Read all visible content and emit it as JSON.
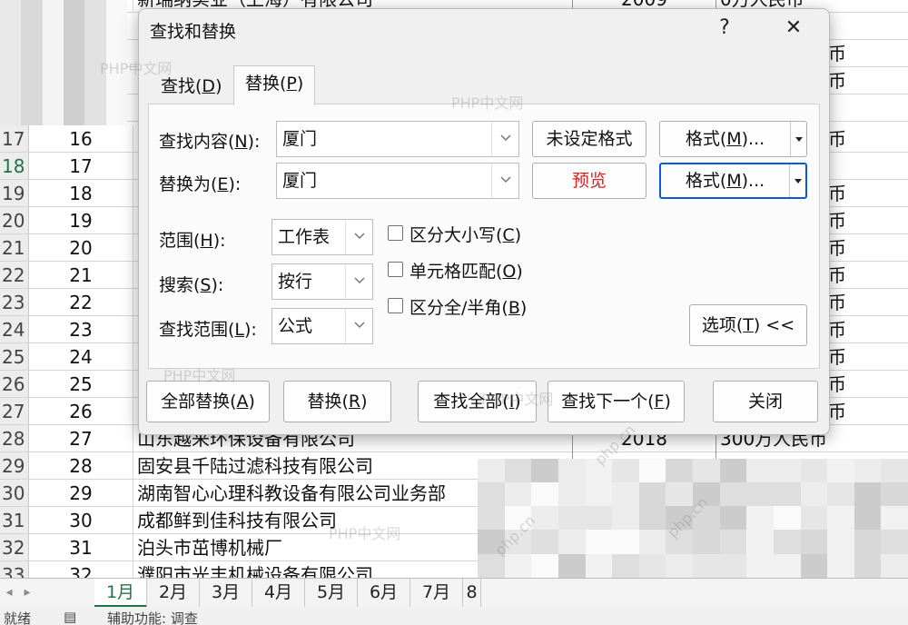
{
  "spreadsheet": {
    "top_partial": {
      "name": "新瑞纳实业（上海）有限公司",
      "year": "2009",
      "capital": "0万人民币"
    },
    "rows": [
      {
        "rownum": "17",
        "id": "16",
        "name": "",
        "year": "",
        "capital": "",
        "edge": "币"
      },
      {
        "rownum": "18",
        "id": "17",
        "name": "",
        "year": "",
        "capital": "",
        "edge": ""
      },
      {
        "rownum": "19",
        "id": "18",
        "name": "",
        "year": "",
        "capital": "",
        "edge": "币"
      },
      {
        "rownum": "20",
        "id": "19",
        "name": "",
        "year": "",
        "capital": "",
        "edge": "币"
      },
      {
        "rownum": "21",
        "id": "20",
        "name": "",
        "year": "",
        "capital": "",
        "edge": "币"
      },
      {
        "rownum": "22",
        "id": "21",
        "name": "",
        "year": "",
        "capital": "",
        "edge": "币"
      },
      {
        "rownum": "23",
        "id": "22",
        "name": "",
        "year": "",
        "capital": "",
        "edge": "币"
      },
      {
        "rownum": "24",
        "id": "23",
        "name": "",
        "year": "",
        "capital": "",
        "edge": "币"
      },
      {
        "rownum": "25",
        "id": "24",
        "name": "",
        "year": "",
        "capital": "",
        "edge": "币"
      },
      {
        "rownum": "26",
        "id": "25",
        "name": "",
        "year": "",
        "capital": "",
        "edge": "币"
      },
      {
        "rownum": "27",
        "id": "26",
        "name": "",
        "year": "",
        "capital": "",
        "edge": "币"
      },
      {
        "rownum": "28",
        "id": "27",
        "name": "山东越来环保设备有限公司",
        "year": "2018",
        "capital": "300万人民币",
        "edge": ""
      },
      {
        "rownum": "29",
        "id": "28",
        "name": "固安县千陆过滤科技有限公司",
        "year": "",
        "capital": "",
        "edge": ""
      },
      {
        "rownum": "30",
        "id": "29",
        "name": "湖南智心心理科教设备有限公司业务部",
        "year": "",
        "capital": "",
        "edge": ""
      },
      {
        "rownum": "31",
        "id": "30",
        "name": "成都鲜到佳科技有限公司",
        "year": "",
        "capital": "",
        "edge": ""
      },
      {
        "rownum": "32",
        "id": "31",
        "name": "泊头市茁博机械厂",
        "year": "",
        "capital": "",
        "edge": ""
      },
      {
        "rownum": "33",
        "id": "32",
        "name": "濮阳市光丰机械设备有限公司",
        "year": "",
        "capital": "",
        "edge": ""
      }
    ],
    "upper_edge": [
      "币",
      "币"
    ],
    "sheet_tabs": [
      "1月",
      "2月",
      "3月",
      "4月",
      "5月",
      "6月",
      "7月",
      "8"
    ],
    "active_sheet": "1月",
    "status": {
      "ready": "就绪",
      "accessibility": "辅助功能: 调查"
    }
  },
  "dialog": {
    "title": "查找和替换",
    "help_label": "?",
    "close_label": "✕",
    "tabs": [
      {
        "text": "查找(",
        "key": "D",
        "tail": ")"
      },
      {
        "text": "替换(",
        "key": "P",
        "tail": ")"
      }
    ],
    "active_tab": "替换(P)",
    "find_label": {
      "text": "查找内容(",
      "key": "N",
      "tail": "):"
    },
    "find_value": "厦门",
    "replace_label": {
      "text": "替换为(",
      "key": "E",
      "tail": "):"
    },
    "replace_value": "厦门",
    "find_format_status": "未设定格式",
    "replace_format_preview": "预览",
    "format_button": {
      "text": "格式(",
      "key": "M",
      "tail": ")..."
    },
    "scope_label": {
      "text": "范围(",
      "key": "H",
      "tail": "):"
    },
    "scope_value": "工作表",
    "search_label": {
      "text": "搜索(",
      "key": "S",
      "tail": "):"
    },
    "search_value": "按行",
    "lookin_label": {
      "text": "查找范围(",
      "key": "L",
      "tail": "):"
    },
    "lookin_value": "公式",
    "match_case": {
      "text": "区分大小写(",
      "key": "C",
      "tail": ")",
      "checked": false
    },
    "match_cell": {
      "text": "单元格匹配(",
      "key": "O",
      "tail": ")",
      "checked": false
    },
    "match_width": {
      "text": "区分全/半角(",
      "key": "B",
      "tail": ")",
      "checked": false
    },
    "options_button": {
      "text": "选项(",
      "key": "T",
      "tail": ") <<"
    },
    "replace_all": {
      "text": "全部替换(",
      "key": "A",
      "tail": ")"
    },
    "replace": {
      "text": "替换(",
      "key": "R",
      "tail": ")"
    },
    "find_all": {
      "text": "查找全部(",
      "key": "I",
      "tail": ")"
    },
    "find_next": {
      "text": "查找下一个(",
      "key": "F",
      "tail": ")"
    },
    "close_button": "关闭",
    "preview_color": "#e02020",
    "focus_color": "#0a5bd6"
  },
  "watermark": {
    "text": "PHP中文网",
    "site": "php.cn"
  }
}
